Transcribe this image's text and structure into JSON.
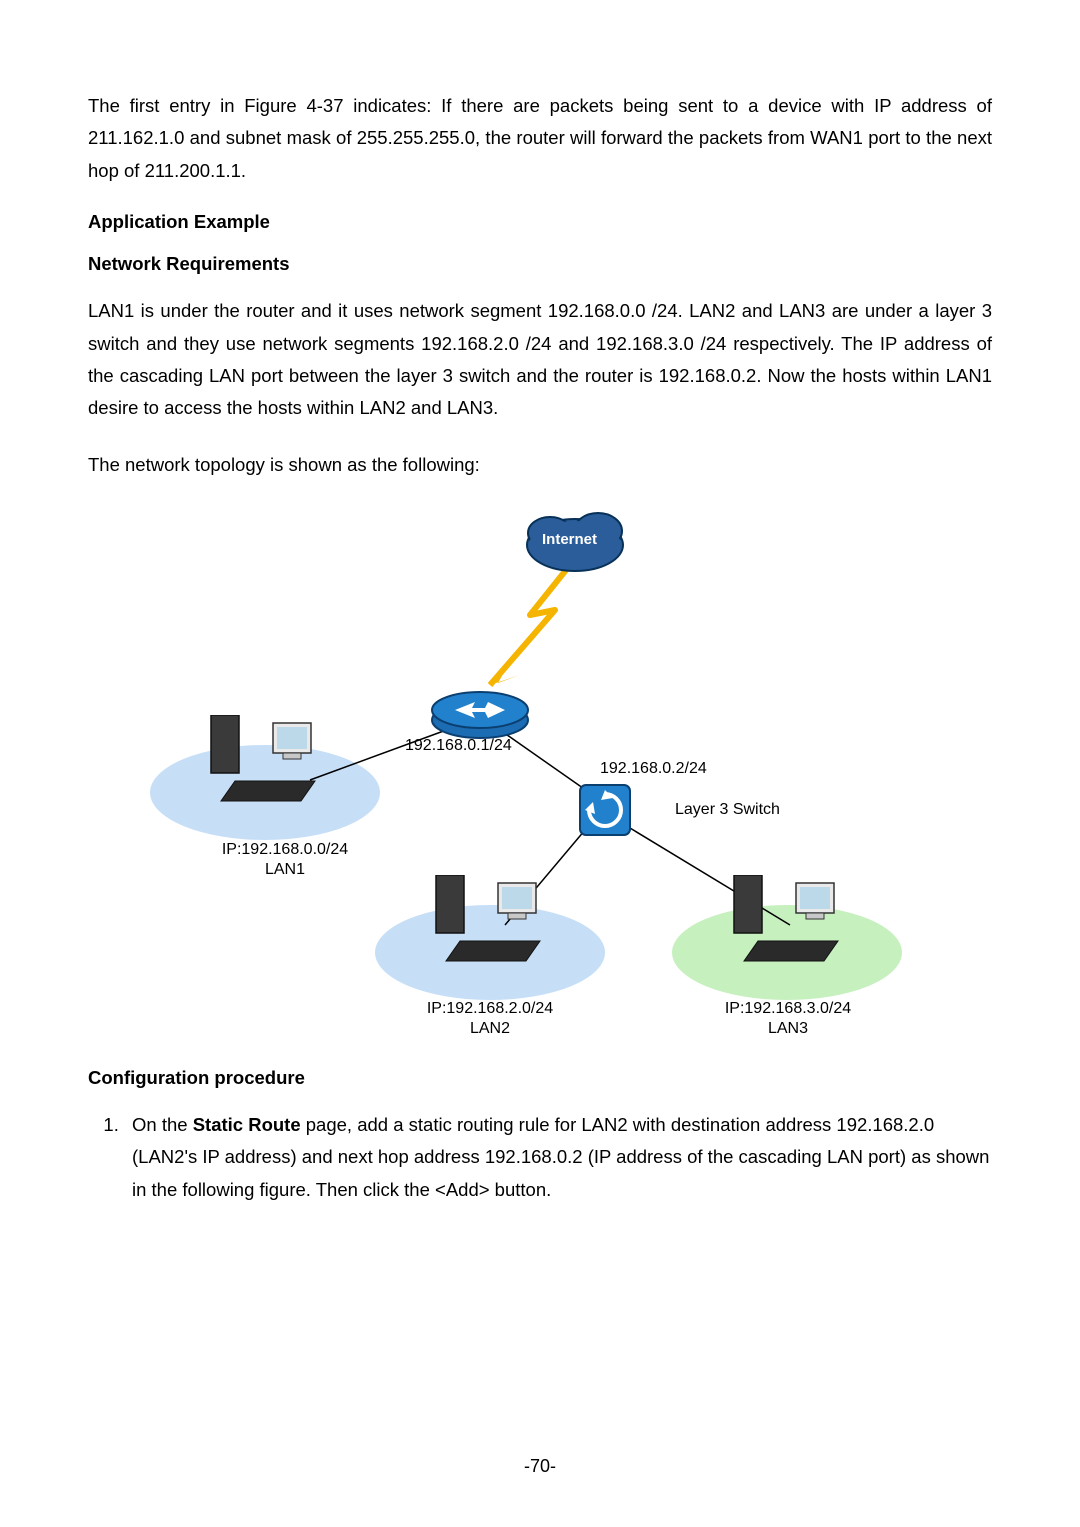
{
  "intro": "The first entry in Figure 4-37 indicates: If there are packets being sent to a device with IP address of 211.162.1.0 and subnet mask of 255.255.255.0, the router will forward the packets from WAN1 port to the next hop of 211.200.1.1.",
  "headings": {
    "example": "Application Example",
    "requirements": "Network Requirements",
    "procedure": "Configuration procedure"
  },
  "requirements_text": "LAN1 is under the router and it uses network segment 192.168.0.0 /24. LAN2 and LAN3 are under a layer 3 switch and they use network segments 192.168.2.0 /24 and 192.168.3.0 /24 respectively. The IP address of the cascading LAN port between the layer 3 switch and the router is 192.168.0.2. Now the hosts within LAN1 desire to access the hosts within LAN2 and LAN3.",
  "topology_intro": "The network topology is shown as the following:",
  "diagram": {
    "internet": "Internet",
    "router_ip": "192.168.0.1/24",
    "switch_ip": "192.168.0.2/24",
    "switch_label": "Layer 3 Switch",
    "lan1_ip": "IP:192.168.0.0/24",
    "lan1_name": "LAN1",
    "lan2_ip": "IP:192.168.2.0/24",
    "lan2_name": "LAN2",
    "lan3_ip": "IP:192.168.3.0/24",
    "lan3_name": "LAN3"
  },
  "procedure": {
    "step1_prefix": "On the ",
    "step1_bold": "Static Route",
    "step1_suffix": " page, add a static routing rule for LAN2 with destination address 192.168.2.0 (LAN2's IP address) and next hop address 192.168.0.2 (IP address of the cascading LAN port) as shown in the following figure. Then click the <Add> button."
  },
  "page_number": "-70-"
}
